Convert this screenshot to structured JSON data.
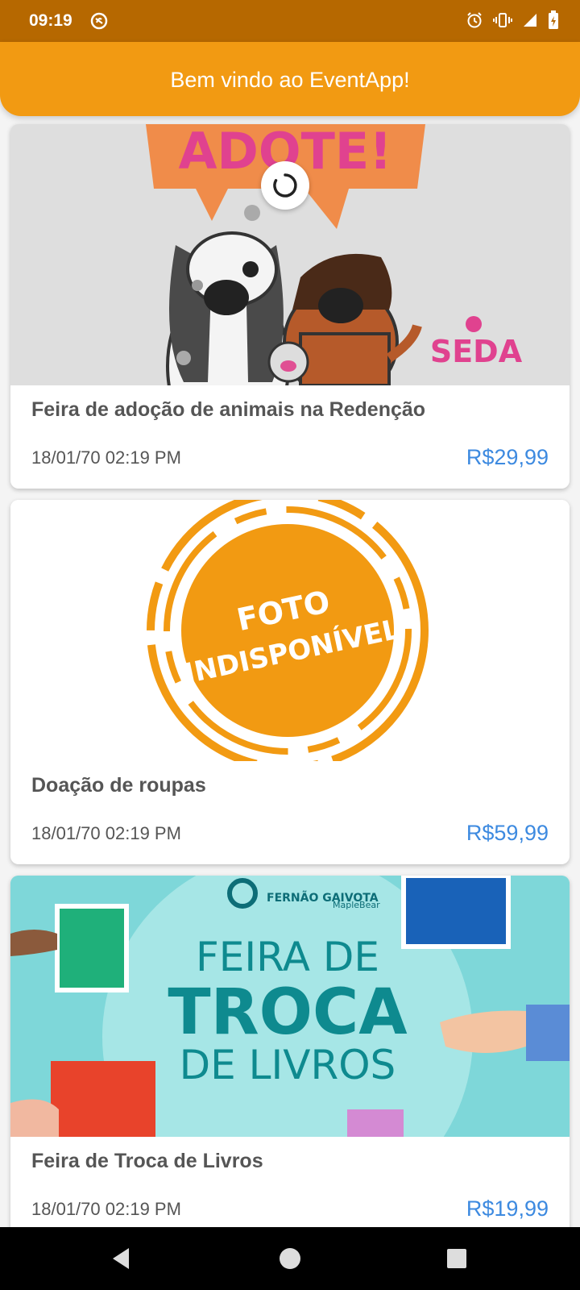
{
  "status_bar": {
    "time": "09:19",
    "icons": [
      "nfc-icon",
      "alarm-icon",
      "vibrate-icon",
      "signal-icon",
      "battery-icon"
    ]
  },
  "app_bar": {
    "title": "Bem vindo ao EventApp!"
  },
  "colors": {
    "primary": "#f29a12",
    "status_bar": "#b66800",
    "price": "#3d8ae0"
  },
  "events": [
    {
      "title": "Feira de adoção de animais na Redenção",
      "date": "18/01/70 02:19 PM",
      "price": "R$29,99",
      "image": {
        "headline": "ADOTE!",
        "logo": "SEDA"
      }
    },
    {
      "title": "Doação de roupas",
      "date": "18/01/70 02:19 PM",
      "price": "R$59,99",
      "image": {
        "line1": "FOTO",
        "line2": "INDISPONÍVEL"
      }
    },
    {
      "title": "Feira de Troca de Livros",
      "date": "18/01/70 02:19 PM",
      "price": "R$19,99",
      "image": {
        "line1": "FEIRA DE",
        "line2": "TROCA",
        "line3": "DE LIVROS",
        "logo1": "FERNÃO GAIVOTA",
        "logo2": "MapleBear"
      }
    }
  ]
}
